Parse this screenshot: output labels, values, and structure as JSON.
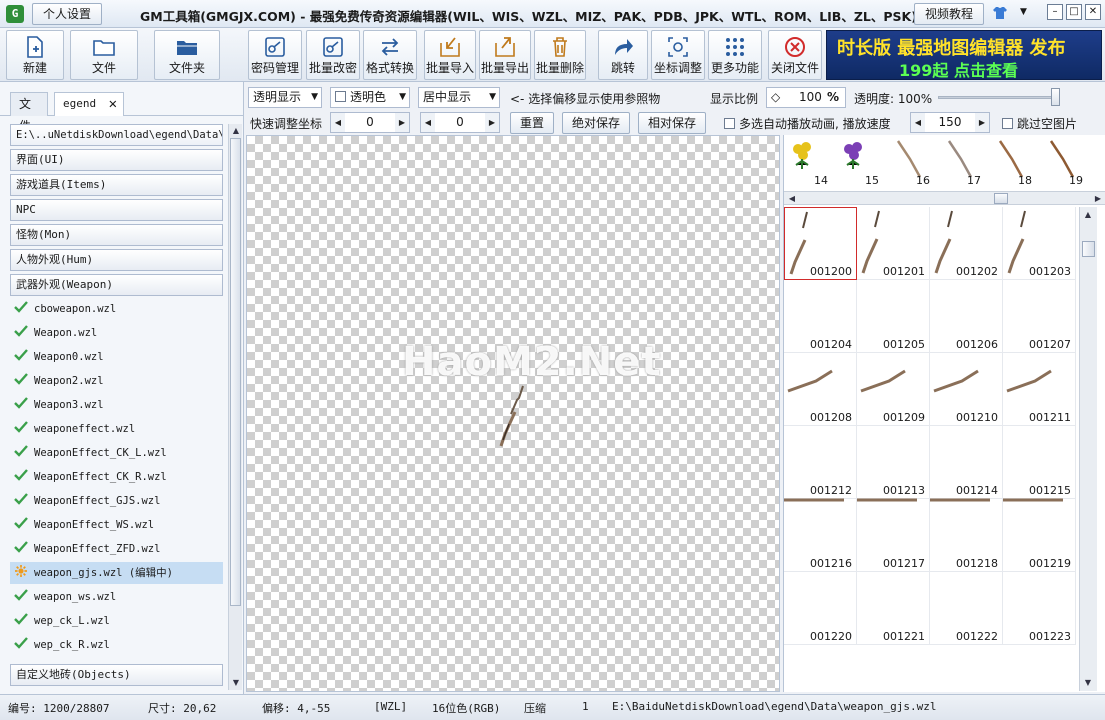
{
  "titlebar": {
    "app_icon": "G",
    "profile_button": "个人设置",
    "title": "GM工具箱(GMGJX.COM) - 最强免费传奇资源编辑器(WIL、WIS、WZL、MIZ、PAK、PDB、JPK、WTL、ROM、LIB、ZL、PSK)",
    "video_button": "视频教程"
  },
  "toolbar": {
    "new": "新建",
    "file": "文件",
    "folder": "文件夹",
    "password": "密码管理",
    "batch_password": "批量改密",
    "convert": "格式转换",
    "batch_import": "批量导入",
    "batch_export": "批量导出",
    "batch_delete": "批量删除",
    "jump": "跳转",
    "coord_adjust": "坐标调整",
    "more": "更多功能",
    "close_file": "关闭文件"
  },
  "banner": {
    "line1": "时长版 最强地图编辑器 发布",
    "line2": "199起 点击查看"
  },
  "left": {
    "tab_file": "文件",
    "tab_legend": "egend",
    "path": "E:\\..uNetdiskDownload\\egend\\Data\\",
    "categories_top": [
      "界面(UI)",
      "游戏道具(Items)",
      "NPC",
      "怪物(Mon)",
      "人物外观(Hum)",
      "武器外观(Weapon)"
    ],
    "files": [
      "cboweapon.wzl",
      "Weapon.wzl",
      "Weapon0.wzl",
      "Weapon2.wzl",
      "Weapon3.wzl",
      "weaponeffect.wzl",
      "WeaponEffect_CK_L.wzl",
      "WeaponEffect_CK_R.wzl",
      "WeaponEffect_GJS.wzl",
      "WeaponEffect_WS.wzl",
      "WeaponEffect_ZFD.wzl",
      "weapon_gjs.wzl (编辑中)",
      "weapon_ws.wzl",
      "wep_ck_L.wzl",
      "wep_ck_R.wzl"
    ],
    "selected_index": 11,
    "category_bottom": "自定义地砖(Objects)"
  },
  "options": {
    "display_mode": "透明显示",
    "transparent_color": "透明色",
    "align": "居中显示",
    "hint": "<- 选择偏移显示使用参照物",
    "scale_label": "显示比例",
    "scale_value": "100",
    "scale_unit": "%",
    "opacity_label": "透明度: 100%",
    "opacity_value": 1.0
  },
  "coords": {
    "label": "快速调整坐标",
    "x": "0",
    "y": "0",
    "reset": "重置",
    "abs_save": "绝对保存",
    "rel_save": "相对保存",
    "autoplay_label": "多选自动播放动画, 播放速度",
    "speed": "150",
    "skip_empty": "跳过空图片"
  },
  "canvas": {
    "watermark": "HaoM2.Net"
  },
  "strip": {
    "numbers": [
      "14",
      "15",
      "16",
      "17",
      "18",
      "19"
    ]
  },
  "thumbs": [
    "001200",
    "001201",
    "001202",
    "001203",
    "001204",
    "001205",
    "001206",
    "001207",
    "001208",
    "001209",
    "001210",
    "001211",
    "001212",
    "001213",
    "001214",
    "001215",
    "001216",
    "001217",
    "001218",
    "001219",
    "001220",
    "001221",
    "001222",
    "001223"
  ],
  "status": {
    "index": "编号: 1200/28807",
    "size": "尺寸: 20,62",
    "offset": "偏移: 4,-55",
    "format": "[WZL]",
    "color_depth": "16位色(RGB)",
    "compress": "压缩",
    "compress_value": "1",
    "path": "E:\\BaiduNetdiskDownload\\egend\\Data\\weapon_gjs.wzl"
  },
  "colors": {
    "accent": "#2f8f3a",
    "selection": "#c6ddf3",
    "banner_yellow": "#ffe22a",
    "banner_green": "#5cff53",
    "close_red": "#d12b2b"
  }
}
